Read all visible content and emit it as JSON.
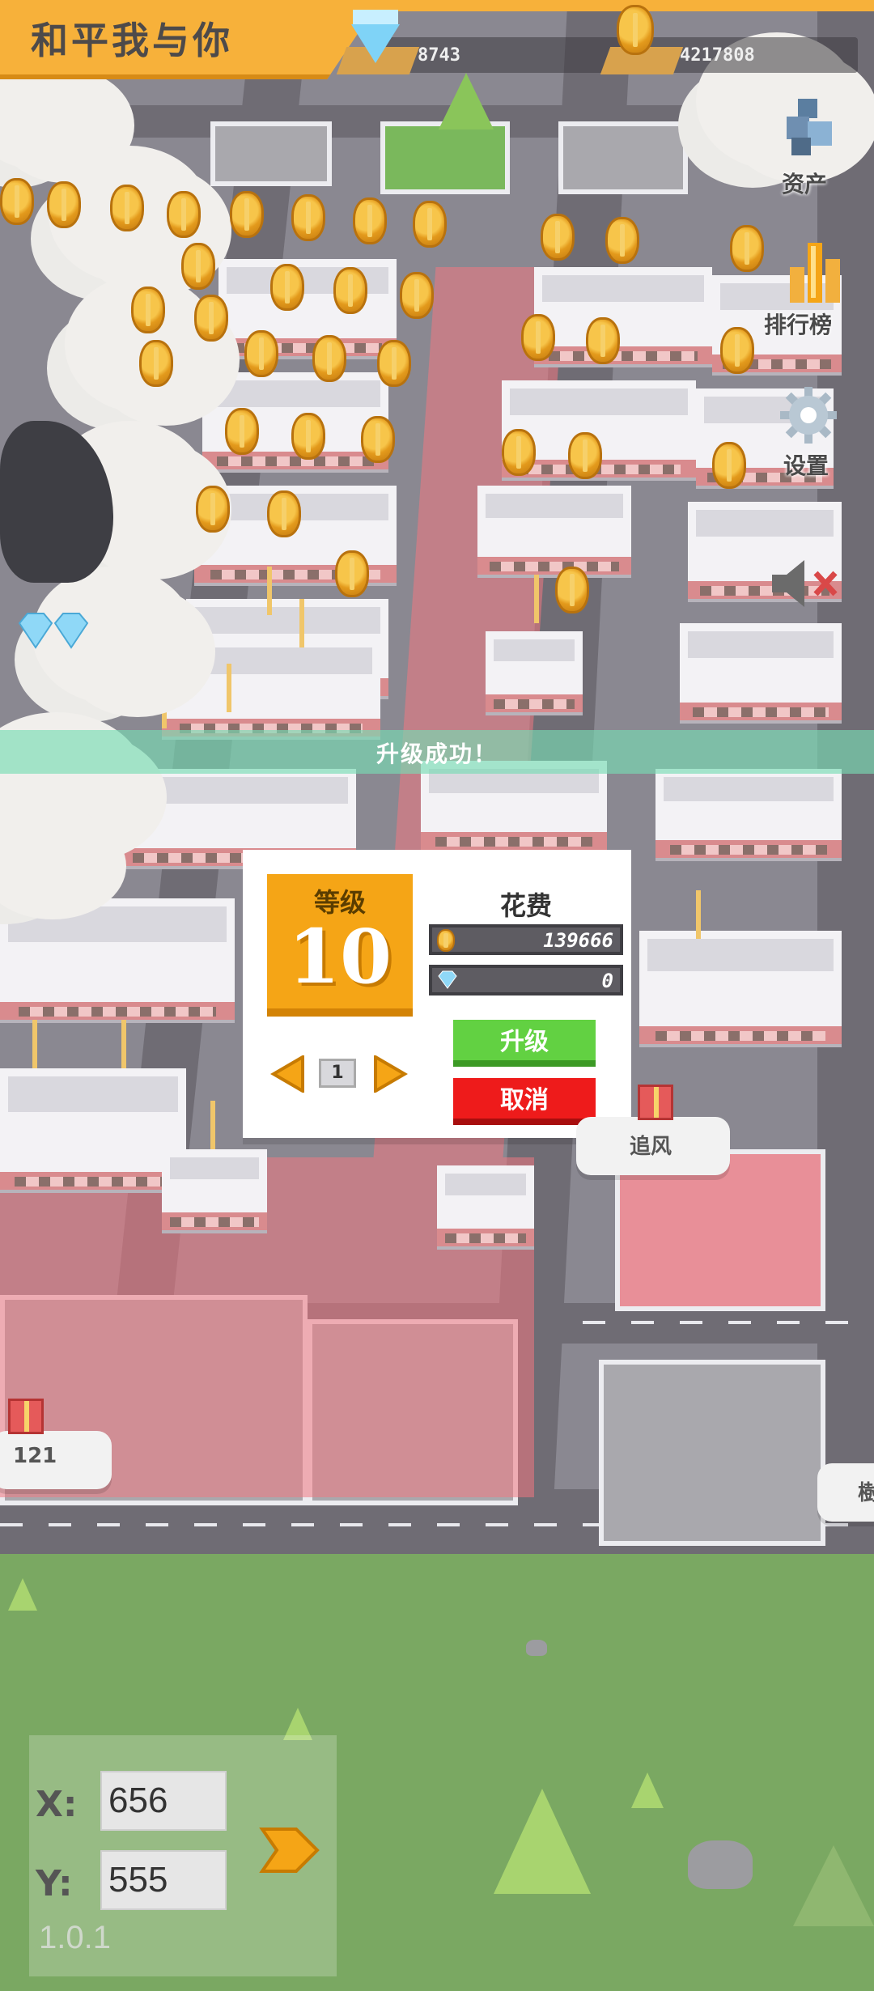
{
  "header": {
    "title": "和平我与你",
    "diamonds": "8743",
    "coins": "4217808",
    "diamond_icon": "diamond-icon",
    "coin_icon": "coin-stack-icon"
  },
  "side_menu": {
    "assets_label": "资产",
    "ranking_label": "排行榜",
    "settings_label": "设置",
    "sound_icon": "speaker-muted-icon"
  },
  "notice": {
    "text": "升级成功！"
  },
  "upgrade_dialog": {
    "level_label": "等级",
    "level_value": "10",
    "cost_title": "花费",
    "coin_cost": "139666",
    "diamond_cost": "0",
    "page": "1",
    "upgrade_label": "升级",
    "cancel_label": "取消"
  },
  "players": [
    {
      "name": "追风"
    },
    {
      "name": "121"
    },
    {
      "name": "樹"
    }
  ],
  "coordinates": {
    "x_label": "X:",
    "y_label": "Y:",
    "x_value": "656",
    "y_value": "555"
  },
  "version": "1.0.1",
  "colors": {
    "accent_orange": "#f5a516",
    "upgrade_green": "#62d142",
    "cancel_red": "#ee1b1b",
    "notice_mint": "#78dcb4"
  }
}
